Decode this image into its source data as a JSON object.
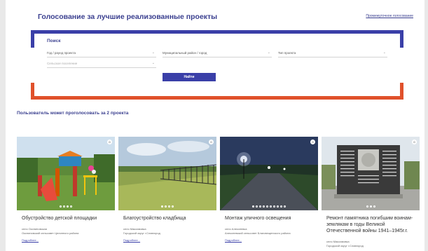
{
  "header": {
    "title": "Голосование за лучшие реализованные проекты",
    "link": "Промежуточное голосование"
  },
  "search": {
    "label": "Поиск",
    "year": "Год / раунд проекта",
    "district": "Муниципальный район / город",
    "type": "Тип проекта",
    "settlement": "Сельское поселение",
    "button": "Найти"
  },
  "vote_note": "Пользователь может проголосовать за 2 проекта",
  "colors": {
    "primary": "#3a3fa8",
    "accent": "#e0512b"
  },
  "cards": [
    {
      "title": "Обустройство детской площадки",
      "place": "село Оксниновская",
      "district": "Оксниновский сельсовет Целинного района",
      "more": "Подробнее...",
      "badge": "0",
      "slides": 4,
      "active": 2
    },
    {
      "title": "Благоустройство кладбища",
      "place": "село Максимовка",
      "district": "Городской округ г.Славгород",
      "more": "Подробнее...",
      "badge": "0",
      "slides": 4,
      "active": 0
    },
    {
      "title": "Монтаж уличного освещения",
      "place": "село Алексеевка",
      "district": "Алексеевский сельсовет Благовещенского района",
      "more": "Подробнее...",
      "badge": "0",
      "slides": 10,
      "active": 0
    },
    {
      "title": "Ремонт памятника погибшим воинам-землякам в годы Великой Отечественной войны 1941–1945г.г.",
      "place": "село Максимовка",
      "district": "Городской округ г.Славгород",
      "more": "",
      "badge": "0",
      "slides": 3,
      "active": 1
    }
  ]
}
